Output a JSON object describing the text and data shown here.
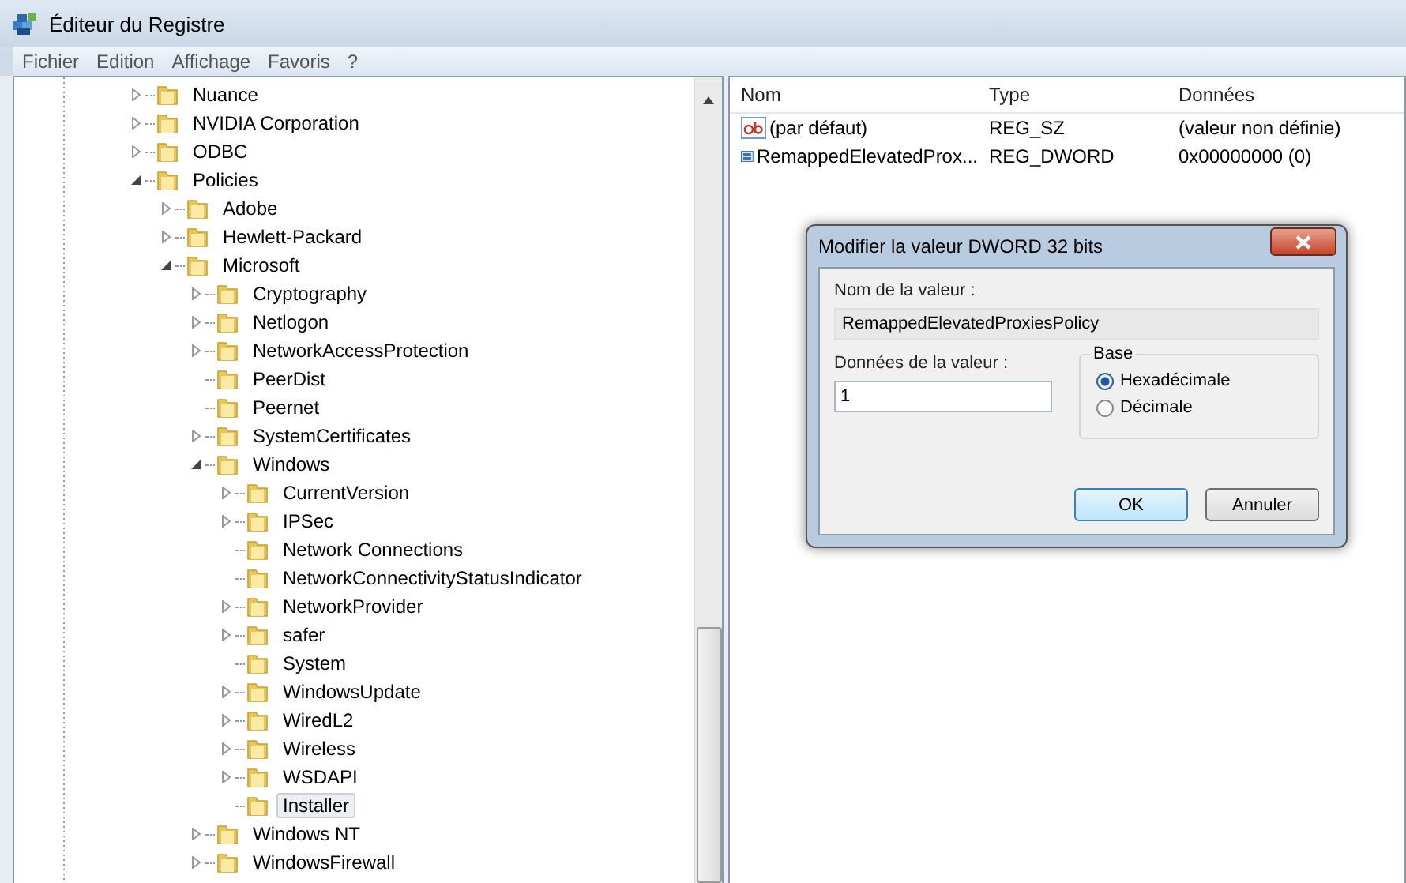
{
  "window": {
    "title": "Éditeur du Registre"
  },
  "menu": [
    "Fichier",
    "Edition",
    "Affichage",
    "Favoris",
    "?"
  ],
  "tree": [
    {
      "label": "Nuance",
      "kind": "branch",
      "expanded": false,
      "selected": false
    },
    {
      "label": "NVIDIA Corporation",
      "kind": "branch",
      "expanded": false,
      "selected": false
    },
    {
      "label": "ODBC",
      "kind": "branch",
      "expanded": false,
      "selected": false
    },
    {
      "label": "Policies",
      "kind": "branch",
      "expanded": true,
      "selected": false,
      "children": [
        {
          "label": "Adobe",
          "kind": "branch",
          "expanded": false,
          "selected": false
        },
        {
          "label": "Hewlett-Packard",
          "kind": "branch",
          "expanded": false,
          "selected": false
        },
        {
          "label": "Microsoft",
          "kind": "branch",
          "expanded": true,
          "selected": false,
          "children": [
            {
              "label": "Cryptography",
              "kind": "branch",
              "expanded": false,
              "selected": false
            },
            {
              "label": "Netlogon",
              "kind": "branch",
              "expanded": false,
              "selected": false
            },
            {
              "label": "NetworkAccessProtection",
              "kind": "branch",
              "expanded": false,
              "selected": false
            },
            {
              "label": "PeerDist",
              "kind": "leaf",
              "selected": false
            },
            {
              "label": "Peernet",
              "kind": "leaf",
              "selected": false
            },
            {
              "label": "SystemCertificates",
              "kind": "branch",
              "expanded": false,
              "selected": false
            },
            {
              "label": "Windows",
              "kind": "branch",
              "expanded": true,
              "selected": false,
              "children": [
                {
                  "label": "CurrentVersion",
                  "kind": "branch",
                  "expanded": false,
                  "selected": false
                },
                {
                  "label": "IPSec",
                  "kind": "branch",
                  "expanded": false,
                  "selected": false
                },
                {
                  "label": "Network Connections",
                  "kind": "leaf",
                  "selected": false
                },
                {
                  "label": "NetworkConnectivityStatusIndicator",
                  "kind": "leaf",
                  "selected": false
                },
                {
                  "label": "NetworkProvider",
                  "kind": "branch",
                  "expanded": false,
                  "selected": false
                },
                {
                  "label": "safer",
                  "kind": "branch",
                  "expanded": false,
                  "selected": false
                },
                {
                  "label": "System",
                  "kind": "leaf",
                  "selected": false
                },
                {
                  "label": "WindowsUpdate",
                  "kind": "branch",
                  "expanded": false,
                  "selected": false
                },
                {
                  "label": "WiredL2",
                  "kind": "branch",
                  "expanded": false,
                  "selected": false
                },
                {
                  "label": "Wireless",
                  "kind": "branch",
                  "expanded": false,
                  "selected": false
                },
                {
                  "label": "WSDAPI",
                  "kind": "branch",
                  "expanded": false,
                  "selected": false
                },
                {
                  "label": "Installer",
                  "kind": "leaf",
                  "selected": true
                }
              ]
            },
            {
              "label": "Windows NT",
              "kind": "branch",
              "expanded": false,
              "selected": false
            },
            {
              "label": "WindowsFirewall",
              "kind": "branch",
              "expanded": false,
              "selected": false
            }
          ]
        }
      ]
    }
  ],
  "values_table": {
    "columns": [
      "Nom",
      "Type",
      "Données"
    ],
    "rows": [
      {
        "kind": "string",
        "name": "(par défaut)",
        "type": "REG_SZ",
        "data": "(valeur non définie)"
      },
      {
        "kind": "binary",
        "name": "RemappedElevatedProx...",
        "type": "REG_DWORD",
        "data": "0x00000000 (0)"
      }
    ]
  },
  "dialog": {
    "title": "Modifier la valeur DWORD 32 bits",
    "name_label": "Nom de la valeur :",
    "name_value": "RemappedElevatedProxiesPolicy",
    "data_label": "Données de la valeur :",
    "data_value": "1",
    "base_label": "Base",
    "radios": [
      {
        "label": "Hexadécimale",
        "selected": true
      },
      {
        "label": "Décimale",
        "selected": false
      }
    ],
    "buttons": [
      {
        "label": "OK",
        "default": true
      },
      {
        "label": "Annuler",
        "default": false
      }
    ]
  }
}
